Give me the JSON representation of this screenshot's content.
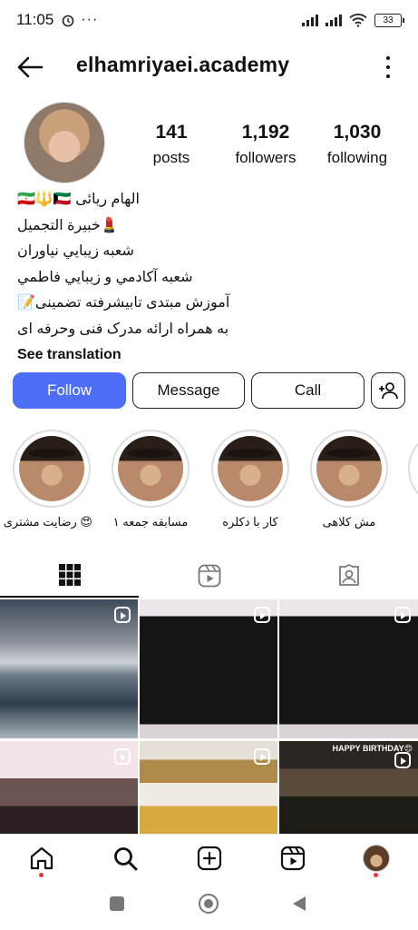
{
  "status": {
    "time": "11:05",
    "battery": "33"
  },
  "header": {
    "username": "elhamriyaei.academy"
  },
  "stats": [
    {
      "num": "141",
      "label": "posts"
    },
    {
      "num": "1,192",
      "label": "followers"
    },
    {
      "num": "1,030",
      "label": "following"
    }
  ],
  "bio": {
    "lines": [
      "🇮🇷🔱🇰🇼 الهام ریائی",
      "💄خبیرة التجمیل",
      "شعبه زيبايي نياوران",
      "شعبه آكادمي و زيبايي فاطمي",
      "آموزش مبتدی تابیشرفته  تضمینی📝",
      "به همراه ارائه مدرک فنی وحرفه ای"
    ],
    "see_translation": "See translation"
  },
  "buttons": {
    "follow": "Follow",
    "message": "Message",
    "call": "Call"
  },
  "highlights": [
    {
      "label": "😍 رضایت مشتری"
    },
    {
      "label": "مسابقه جمعه ۱"
    },
    {
      "label": "کار با دکلره"
    },
    {
      "label": "مش کلاهی"
    }
  ],
  "grid": {
    "birthday_text": "HAPPY BIRTHDAY😍"
  },
  "icons": {
    "back": "arrow-left-icon",
    "more": "more-vertical-icon",
    "add_user": "add-person-icon",
    "grid": "grid-icon",
    "reels": "reels-icon",
    "tagged": "tagged-icon",
    "home": "home-icon",
    "search": "search-icon",
    "create": "plus-square-icon",
    "reels_nav": "reels-icon",
    "profile": "profile-avatar"
  },
  "colors": {
    "follow_button": "#4f6ef7",
    "notification_dot": "#ee3333"
  }
}
